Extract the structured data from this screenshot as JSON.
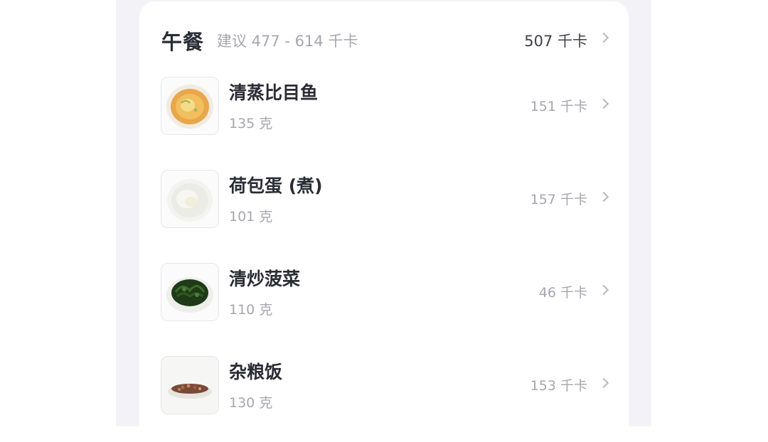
{
  "meal": {
    "title": "午餐",
    "suggestion": "建议 477 - 614 千卡",
    "total": "507 千卡"
  },
  "items": [
    {
      "name": "清蒸比目鱼",
      "weight": "135 克",
      "kcal": "151 千卡",
      "icon": "steamed-fish-dish"
    },
    {
      "name": "荷包蛋 (煮)",
      "weight": "101 克",
      "kcal": "157 千卡",
      "icon": "poached-egg-bowl"
    },
    {
      "name": "清炒菠菜",
      "weight": "110 克",
      "kcal": "46 千卡",
      "icon": "stir-fried-spinach-plate"
    },
    {
      "name": "杂粮饭",
      "weight": "130 克",
      "kcal": "153 千卡",
      "icon": "multigrain-rice-plate"
    }
  ]
}
